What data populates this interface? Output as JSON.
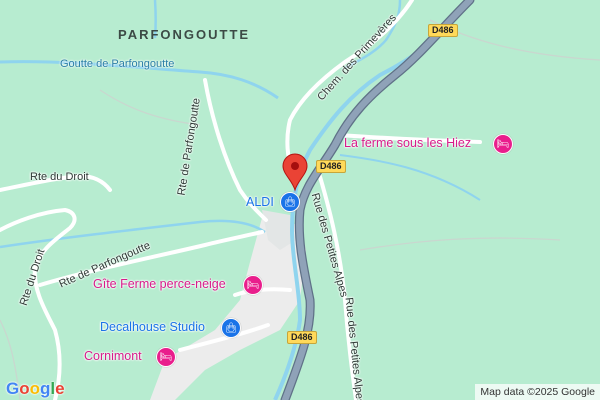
{
  "map": {
    "village": "PARFONGOUTTE",
    "road_shields": [
      "D486",
      "D486",
      "D486"
    ],
    "roads": {
      "chem_primeveres": "Chem. des Primevères",
      "rte_parfongoutte_1": "Rte de Parfongoutte",
      "rte_parfongoutte_2": "Rte de Parfongoutte",
      "rte_du_droit_1": "Rte du Droit",
      "rte_du_droit_2": "Rte du Droit",
      "rue_petites_alpes_1": "Rue des Petites Alpes",
      "rue_petites_alpes_2": "Rue des Petites Alpes"
    },
    "water": {
      "goutte": "Goutte de Parfongoutte"
    },
    "pois": {
      "ferme": "La ferme sous les Hiez",
      "aldi": "ALDI",
      "gite": "Gîte Ferme perce-neige",
      "decalhouse": "Decalhouse Studio",
      "cornimont": "Cornimont"
    },
    "colors": {
      "background": "#b7ecd0",
      "main_road": "#8fa2b8",
      "water": "#8fd4ee",
      "town": "#ececec",
      "poi_pink": "#d81b8a",
      "poi_blue": "#1a73e8",
      "marker": "#ea4335"
    },
    "icons": {
      "lodging": "bed-icon",
      "shopping": "shopping-bag-icon",
      "marker": "map-pin-icon"
    }
  },
  "logo": {
    "g1": "G",
    "o1": "o",
    "o2": "o",
    "g2": "g",
    "l": "l",
    "e": "e"
  },
  "attribution": "Map data ©2025 Google"
}
